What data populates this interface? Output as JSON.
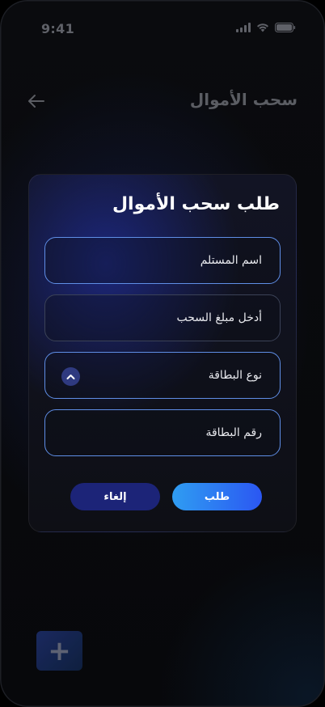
{
  "status_bar": {
    "time": "9:41"
  },
  "header": {
    "title": "سحب الأموال"
  },
  "modal": {
    "title": "طلب سحب الأموال",
    "fields": [
      {
        "label": "اسم المستلم"
      },
      {
        "label": "أدخل مبلغ السحب"
      },
      {
        "label": "نوع البطاقة",
        "icon": "chevron-up-icon"
      },
      {
        "label": "رقم البطاقة"
      }
    ],
    "request_label": "طلب",
    "cancel_label": "إلغاء"
  },
  "fab": {
    "label": "+"
  },
  "colors": {
    "primary_gradient_start": "#2f9df2",
    "primary_gradient_end": "#2b57f2",
    "cancel_button": "#1c2478",
    "field_highlight_border": "#5f8ee6"
  }
}
